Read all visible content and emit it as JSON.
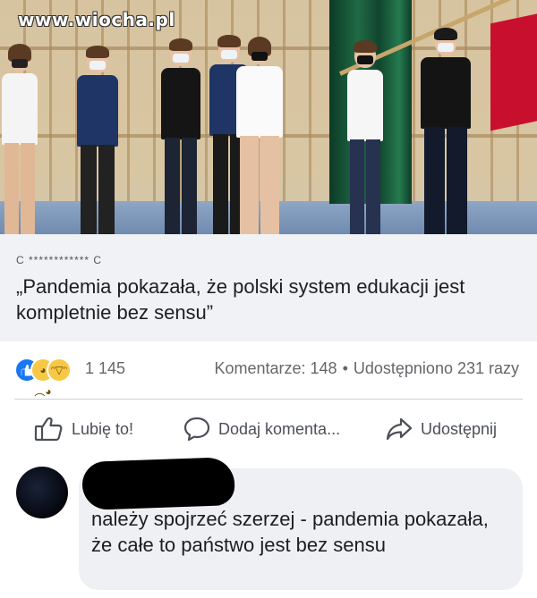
{
  "watermark": "www.wiocha.pl",
  "post": {
    "source_label": "C ************ C",
    "headline": "„Pandemia pokazała, że polski system edukacji jest kompletnie bez sensu”",
    "reactions": {
      "icons": [
        "like-icon",
        "sad-icon",
        "haha-icon"
      ],
      "count": "1 145"
    },
    "comments_label": "Komentarze: 148",
    "separator": "•",
    "shares_label": "Udostępniono 231 razy"
  },
  "actions": {
    "like_label": "Lubię to!",
    "comment_label": "Dodaj komenta...",
    "share_label": "Udostępnij"
  },
  "comment": {
    "text": "należy spojrzeć szerzej - pandemia pokazała, że całe to państwo jest bez sensu"
  },
  "colors": {
    "brand_blue": "#1877f2",
    "text_primary": "#1c1e21",
    "text_secondary": "#65676b",
    "bubble_bg": "#eef0f3",
    "flag_red": "#c8102e"
  }
}
